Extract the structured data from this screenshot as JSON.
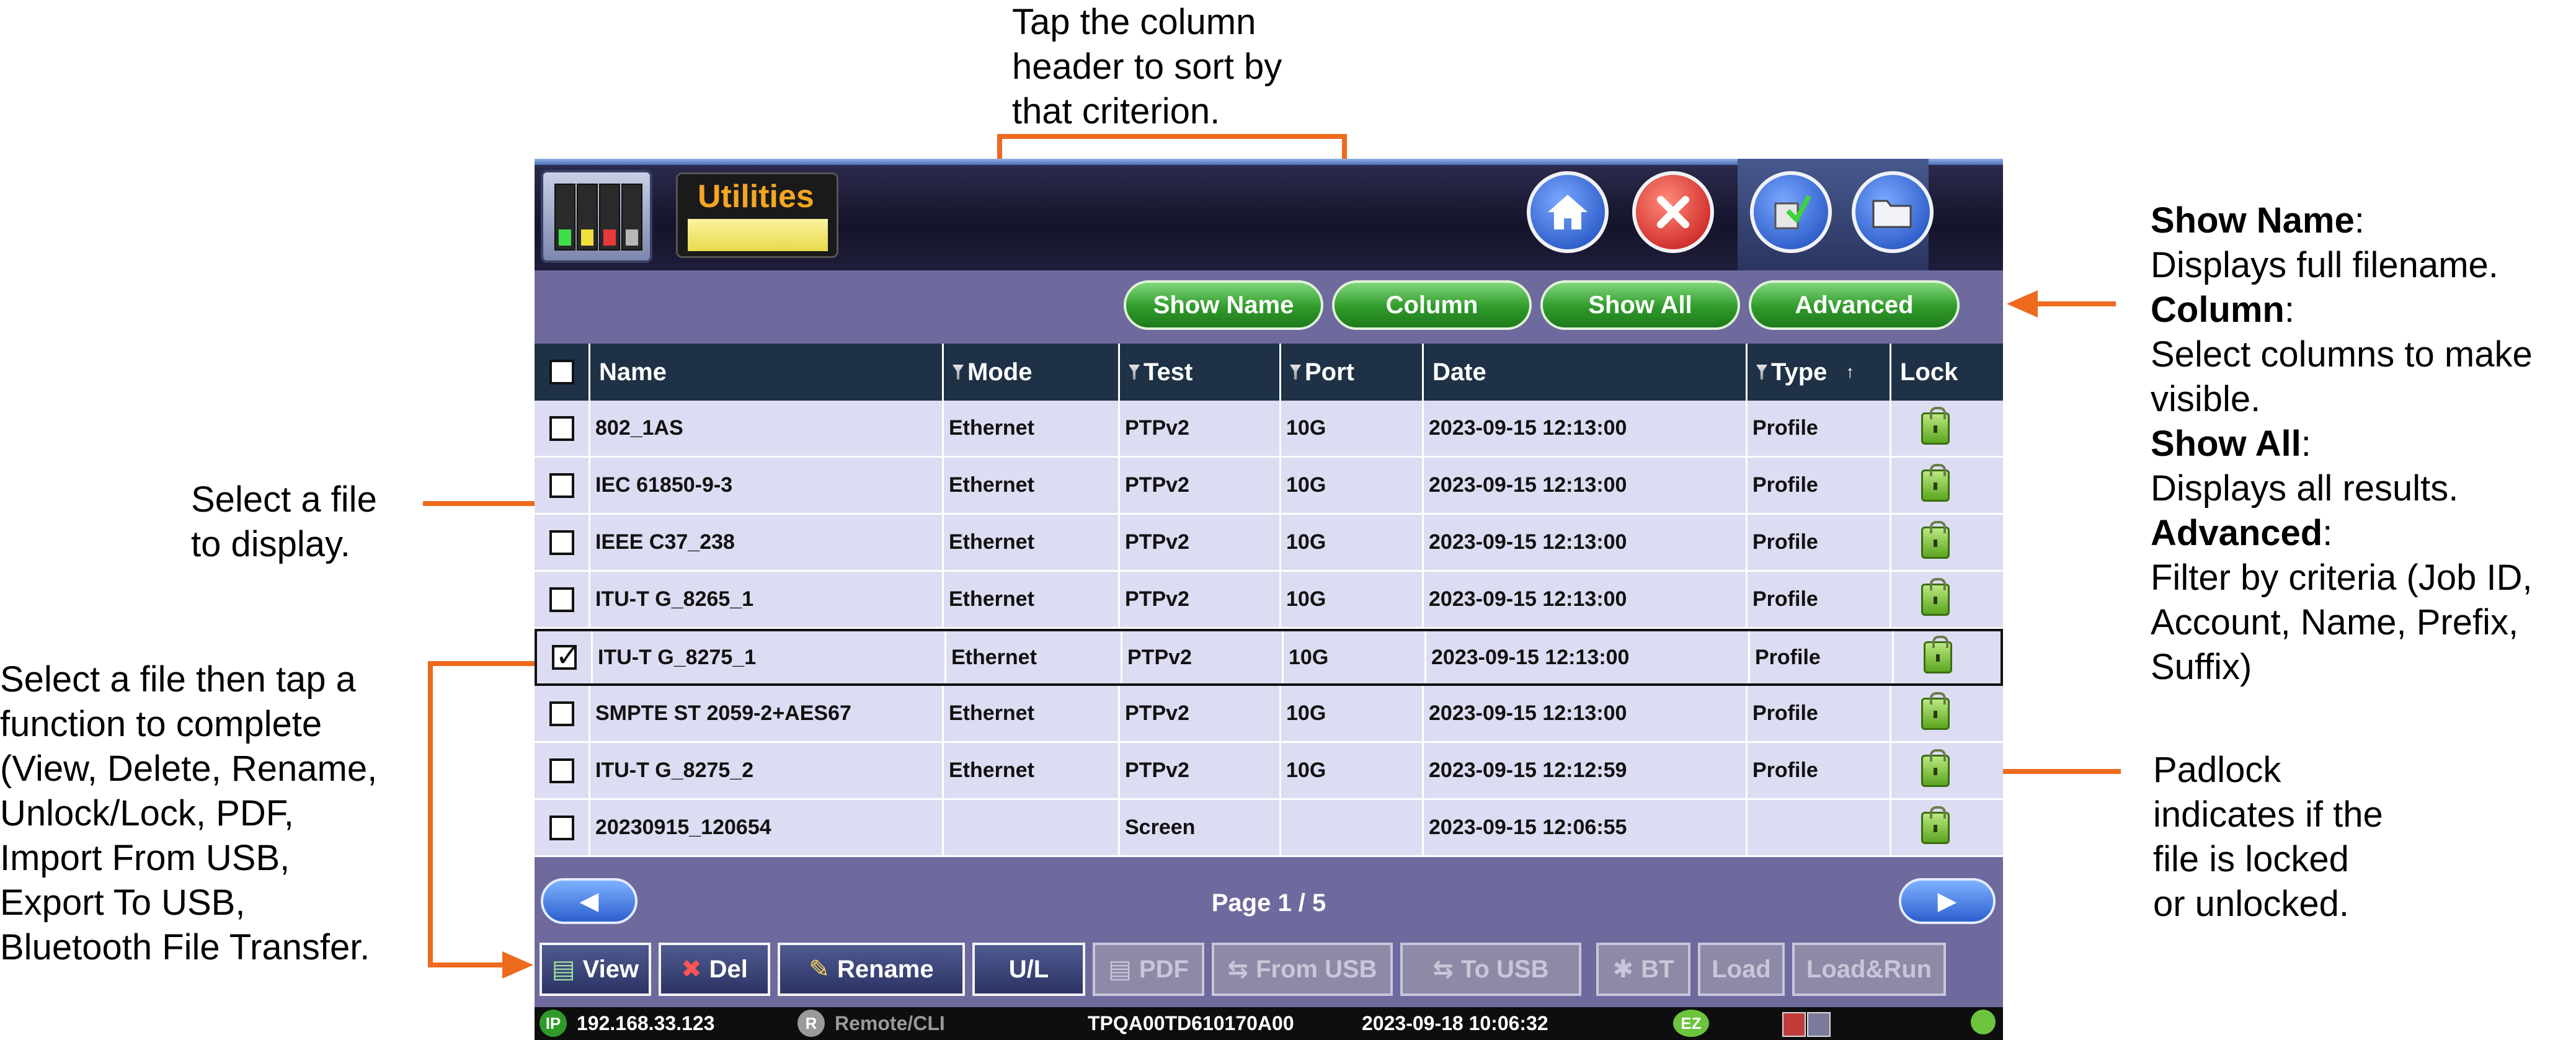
{
  "annotations": {
    "sort_hint": [
      "Tap the column",
      "header to sort by",
      "that criterion."
    ],
    "select_file": [
      "Select a file",
      "to display."
    ],
    "select_then_function": [
      "Select a file then tap a",
      "function to complete",
      "(View, Delete, Rename,",
      "Unlock/Lock, PDF,",
      "Import From USB,",
      "Export To USB,",
      "Bluetooth File Transfer."
    ],
    "right_panel": {
      "show_name_title": "Show Name",
      "show_name_desc": "Displays full filename.",
      "column_title": "Column",
      "column_desc": [
        "Select columns to make",
        "visible."
      ],
      "show_all_title": "Show All",
      "show_all_desc": "Displays all results.",
      "advanced_title": "Advanced",
      "advanced_desc": [
        "Filter by criteria (Job ID,",
        "Account, Name, Prefix,",
        "Suffix)"
      ],
      "colon": ":"
    },
    "padlock_note": [
      "Padlock",
      "indicates if the",
      "file is locked",
      "or unlocked."
    ]
  },
  "app": {
    "title": "Utilities"
  },
  "toolbar": {
    "show_name": "Show Name",
    "column": "Column",
    "show_all": "Show All",
    "advanced": "Advanced"
  },
  "table": {
    "headers": [
      "Name",
      "Mode",
      "Test",
      "Port",
      "Date",
      "Type",
      "Lock"
    ],
    "sort_indicator": "↑",
    "rows": [
      {
        "checked": false,
        "name": "802_1AS",
        "mode": "Ethernet",
        "test": "PTPv2",
        "port": "10G",
        "date": "2023-09-15 12:13:00",
        "type": "Profile"
      },
      {
        "checked": false,
        "name": "IEC 61850-9-3",
        "mode": "Ethernet",
        "test": "PTPv2",
        "port": "10G",
        "date": "2023-09-15 12:13:00",
        "type": "Profile"
      },
      {
        "checked": false,
        "name": "IEEE C37_238",
        "mode": "Ethernet",
        "test": "PTPv2",
        "port": "10G",
        "date": "2023-09-15 12:13:00",
        "type": "Profile"
      },
      {
        "checked": false,
        "name": "ITU-T G_8265_1",
        "mode": "Ethernet",
        "test": "PTPv2",
        "port": "10G",
        "date": "2023-09-15 12:13:00",
        "type": "Profile"
      },
      {
        "checked": true,
        "name": "ITU-T G_8275_1",
        "mode": "Ethernet",
        "test": "PTPv2",
        "port": "10G",
        "date": "2023-09-15 12:13:00",
        "type": "Profile"
      },
      {
        "checked": false,
        "name": "SMPTE ST 2059-2+AES67",
        "mode": "Ethernet",
        "test": "PTPv2",
        "port": "10G",
        "date": "2023-09-15 12:13:00",
        "type": "Profile"
      },
      {
        "checked": false,
        "name": "ITU-T G_8275_2",
        "mode": "Ethernet",
        "test": "PTPv2",
        "port": "10G",
        "date": "2023-09-15 12:12:59",
        "type": "Profile"
      },
      {
        "checked": false,
        "name": "20230915_120654",
        "mode": "",
        "test": "Screen",
        "port": "",
        "date": "2023-09-15 12:06:55",
        "type": ""
      }
    ]
  },
  "pager": {
    "label": "Page 1 / 5",
    "prev": "◀",
    "next": "▶"
  },
  "functions": {
    "view": "View",
    "del": "Del",
    "rename": "Rename",
    "ul": "U/L",
    "pdf": "PDF",
    "from_usb": "From USB",
    "to_usb": "To USB",
    "bt": "BT",
    "load": "Load",
    "load_run": "Load&Run"
  },
  "status": {
    "ip_badge": "IP",
    "ip": "192.168.33.123",
    "remote_badge": "R",
    "remote": "Remote/CLI",
    "serial": "TPQA00TD610170A00",
    "datetime": "2023-09-18  10:06:32",
    "ez": "EZ"
  },
  "colors": {
    "accent": "#ee6a1e",
    "panel": "#6e6a9e",
    "header": "#1e3146",
    "row": "#dcdcf2",
    "button_green": "#2f9a2a"
  }
}
